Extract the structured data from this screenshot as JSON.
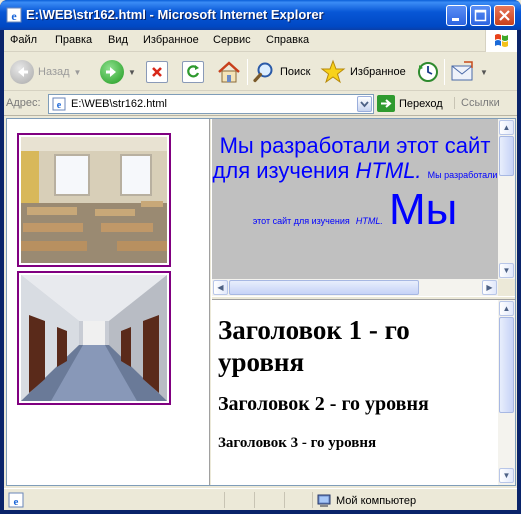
{
  "window": {
    "title": "E:\\WEB\\str162.html - Microsoft Internet Explorer"
  },
  "menu": [
    "Файл",
    "Правка",
    "Вид",
    "Избранное",
    "Сервис",
    "Справка"
  ],
  "toolbar": {
    "back_label": "Назад",
    "search_label": "Поиск",
    "favorites_label": "Избранное"
  },
  "address": {
    "label": "Адрес:",
    "value": "E:\\WEB\\str162.html",
    "go_label": "Переход",
    "links_label": "Ссылки"
  },
  "top_frame": {
    "big_text_a": "Мы разработали этот сайт для изучения",
    "big_text_b": "HTML.",
    "small_text_a": "Мы разработали этот сайт для изучения",
    "small_text_b": "HTML.",
    "huge_text": "Мы"
  },
  "bottom_frame": {
    "h1": "Заголовок 1 - го уровня",
    "h2": "Заголовок 2 - го уровня",
    "h3": "Заголовок 3 - го уровня"
  },
  "status": {
    "zone_label": "Мой компьютер"
  },
  "colors": {
    "title_bar": "#0054e3",
    "frame_text": "#0000ff",
    "photo_border": "#800080",
    "top_frame_bg": "#c0c0c0"
  },
  "icons": [
    "ie-icon",
    "minimize-icon",
    "maximize-icon",
    "close-icon",
    "windows-logo-icon",
    "back-icon",
    "forward-icon",
    "stop-icon",
    "refresh-icon",
    "home-icon",
    "search-icon",
    "favorites-icon",
    "history-icon",
    "mail-icon",
    "page-icon",
    "go-icon",
    "computer-icon"
  ]
}
